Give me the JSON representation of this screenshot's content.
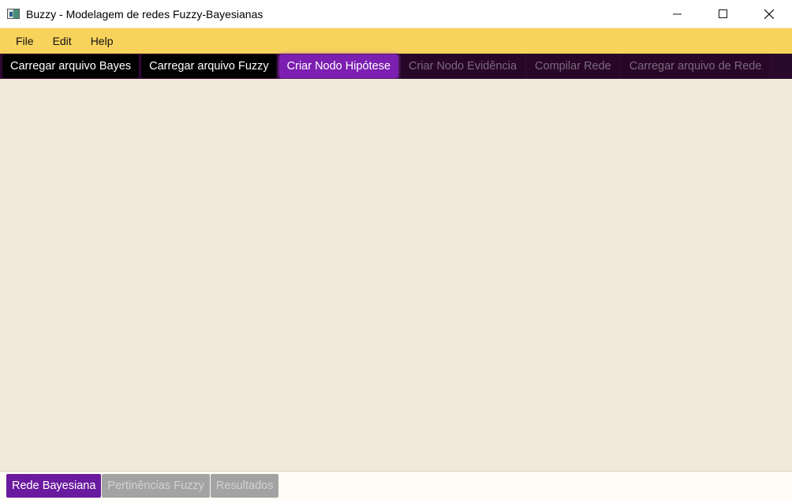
{
  "window": {
    "title": "Buzzy - Modelagem de redes Fuzzy-Bayesianas",
    "app_icon": "app-window-icon",
    "controls": [
      "minimize-icon",
      "maximize-icon",
      "close-icon"
    ]
  },
  "menu": {
    "items": [
      "File",
      "Edit",
      "Help"
    ]
  },
  "toolbar": {
    "buttons": [
      {
        "label": "Carregar arquivo Bayes",
        "state": "enabled"
      },
      {
        "label": "Carregar arquivo Fuzzy",
        "state": "enabled"
      },
      {
        "label": "Criar Nodo Hipótese",
        "state": "active"
      },
      {
        "label": "Criar Nodo Evidência",
        "state": "disabled"
      },
      {
        "label": "Compilar Rede",
        "state": "disabled"
      },
      {
        "label": "Carregar arquivo de Rede",
        "state": "disabled"
      }
    ]
  },
  "tabs": {
    "items": [
      {
        "label": "Rede Bayesiana",
        "state": "active"
      },
      {
        "label": "Pertinências Fuzzy",
        "state": "inactive"
      },
      {
        "label": "Resultados",
        "state": "inactive"
      }
    ]
  },
  "colors": {
    "menubar": "#f8d35c",
    "toolbar": "#2a0a2c",
    "accent": "#7c1fb0",
    "canvas": "#f0e8d8",
    "tab_active": "#6a1a9e"
  }
}
